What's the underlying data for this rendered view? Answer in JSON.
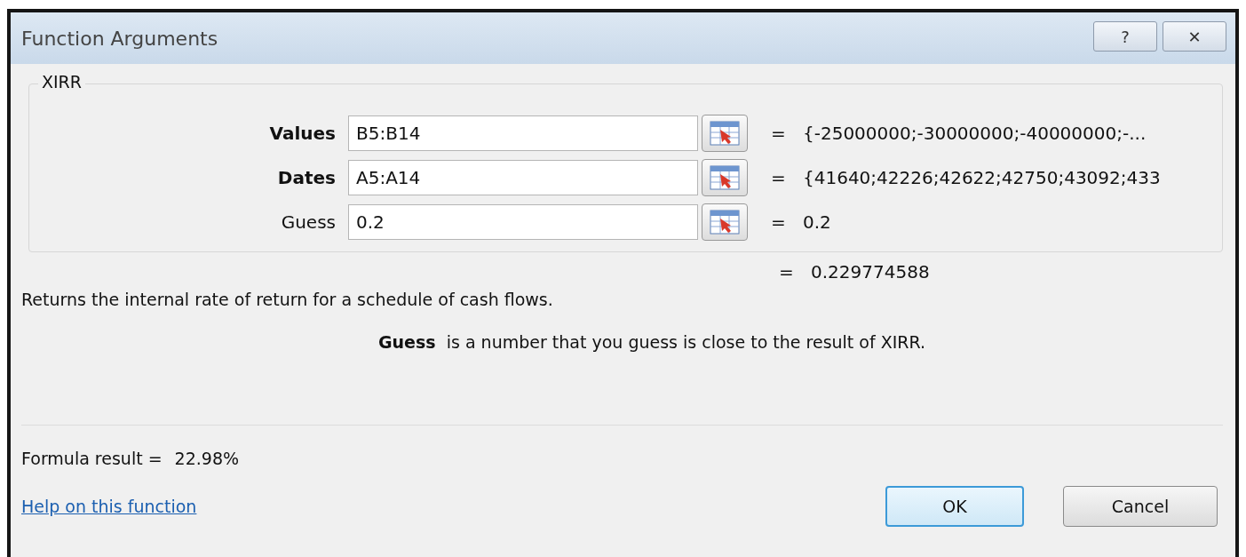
{
  "window": {
    "title": "Function Arguments",
    "buttons": [
      "?",
      "✕"
    ]
  },
  "group": {
    "title": "XIRR",
    "arguments": [
      {
        "label": "Values",
        "bold": true,
        "value": "B5:B14",
        "equals": "=",
        "result": "{-25000000;-30000000;-40000000;-..."
      },
      {
        "label": "Dates",
        "bold": true,
        "value": "A5:A14",
        "equals": "=",
        "result": "{41640;42226;42622;42750;43092;433"
      },
      {
        "label": "Guess",
        "bold": false,
        "value": "0.2",
        "equals": "=",
        "result": "0.2"
      }
    ]
  },
  "function_result": {
    "equals": "=",
    "value": "0.229774588"
  },
  "description": "Returns the internal rate of return for a schedule of cash flows.",
  "argument_help": "**Guess**  is a number that you guess is close to the result of XIRR.",
  "formula_result": {
    "label": "Formula result =",
    "value": "22.98%"
  },
  "help_link": "Help on this function",
  "buttons": [
    {
      "label": "OK",
      "default": true
    },
    {
      "label": "Cancel",
      "default": false
    }
  ]
}
